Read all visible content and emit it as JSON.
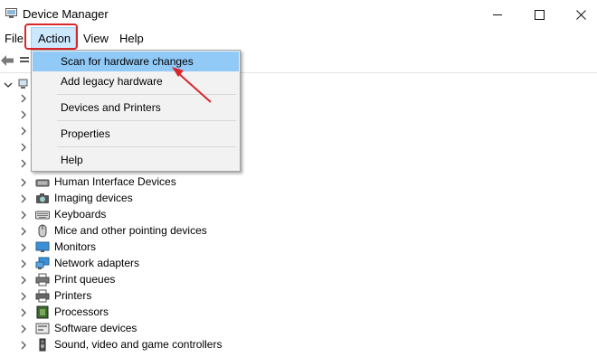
{
  "window": {
    "title": "Device Manager",
    "controls": [
      "minimize",
      "maximize",
      "close"
    ]
  },
  "menubar": {
    "items": [
      {
        "label": "File"
      },
      {
        "label": "Action"
      },
      {
        "label": "View"
      },
      {
        "label": "Help"
      }
    ],
    "active": "Action"
  },
  "action_menu": {
    "items": [
      {
        "label": "Scan for hardware changes",
        "highlighted": true
      },
      {
        "label": "Add legacy hardware"
      },
      {
        "label": "Devices and Printers"
      },
      {
        "label": "Properties"
      },
      {
        "label": "Help"
      }
    ]
  },
  "tree": {
    "devices": [
      {
        "label": "Human Interface Devices",
        "icon": "hid-icon"
      },
      {
        "label": "Imaging devices",
        "icon": "camera-icon"
      },
      {
        "label": "Keyboards",
        "icon": "keyboard-icon"
      },
      {
        "label": "Mice and other pointing devices",
        "icon": "mouse-icon"
      },
      {
        "label": "Monitors",
        "icon": "monitor-icon"
      },
      {
        "label": "Network adapters",
        "icon": "network-icon"
      },
      {
        "label": "Print queues",
        "icon": "print-queue-icon"
      },
      {
        "label": "Printers",
        "icon": "printer-icon"
      },
      {
        "label": "Processors",
        "icon": "processor-icon"
      },
      {
        "label": "Software devices",
        "icon": "software-device-icon"
      },
      {
        "label": "Sound, video and game controllers",
        "icon": "speaker-icon"
      }
    ]
  },
  "colors": {
    "menu_highlight": "#cce8ff",
    "dropdown_highlight": "#91c9f7",
    "annotation_red": "#d9262b"
  }
}
